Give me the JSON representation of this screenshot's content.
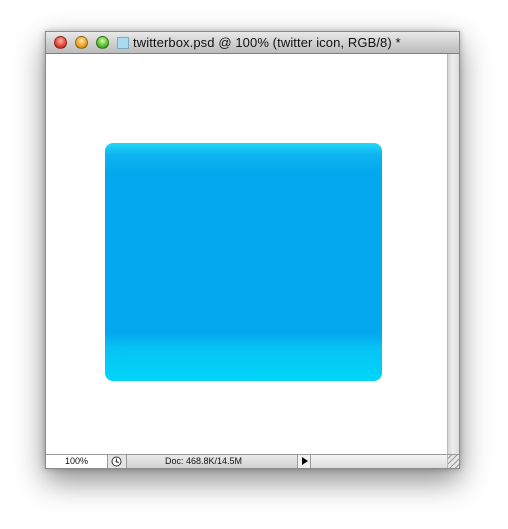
{
  "window": {
    "title": "twitterbox.psd @ 100% (twitter icon, RGB/8) *"
  },
  "icons": {
    "close": "close-icon",
    "minimize": "minimize-icon",
    "zoom": "zoom-icon",
    "document": "document-icon",
    "status": "status-indicator-icon",
    "menu_arrow": "play-arrow-icon",
    "grip": "resize-grip-icon"
  },
  "colors": {
    "box_main": "#03a8ee",
    "box_highlight": "#00d6f9"
  },
  "statusbar": {
    "zoom": "100%",
    "doc_info": "Doc: 468.8K/14.5M"
  }
}
